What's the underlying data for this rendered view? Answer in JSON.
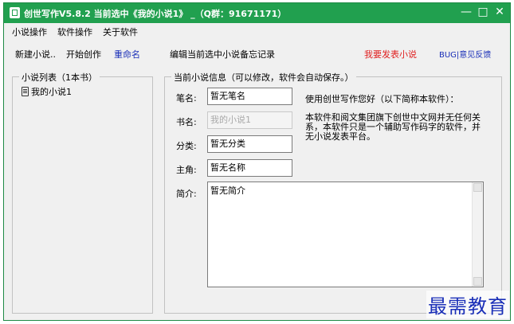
{
  "title": {
    "text": "创世写作V5.8.2 当前选中《我的小说1》 _（Q群：91671171）",
    "controls": {
      "minimize": "—",
      "maximize": "□",
      "close": "✕"
    }
  },
  "menu": [
    "小说操作",
    "软件操作",
    "关于软件"
  ],
  "toolbar": {
    "new_novel": "新建小说..",
    "start_writing": "开始创作",
    "rename": "重命名",
    "edit_notes": "编辑当前选中小说备忘记录",
    "publish": "我要发表小说",
    "bug_feedback": "BUG|意见反馈"
  },
  "novel_list": {
    "title": "小说列表（1本书）",
    "items": [
      "我的小说1"
    ]
  },
  "novel_info": {
    "title": "当前小说信息（可以修改，软件会自动保存。）",
    "pen_name_label": "笔名:",
    "pen_name": "暂无笔名",
    "book_name_label": "书名:",
    "book_name": "我的小说1",
    "category_label": "分类:",
    "category": "暂无分类",
    "protagonist_label": "主角:",
    "protagonist": "暂无名称",
    "synopsis_label": "简介:",
    "synopsis": "暂无简介"
  },
  "notice": {
    "heading": "使用创世写作您好（以下简称本软件）：",
    "lines": [
      "本软件和阅文集团旗下创世中文网并无任何关",
      "系，本软件只是一个辅助写作码字的软件，并",
      "无小说发表平台。"
    ]
  },
  "watermark": "最需教育",
  "colors": {
    "titlebar": "#21a04f",
    "publish_link": "#e02020",
    "link_blue": "#1a2fb8"
  },
  "icons": {
    "app": "app-icon",
    "book": "book-icon"
  }
}
